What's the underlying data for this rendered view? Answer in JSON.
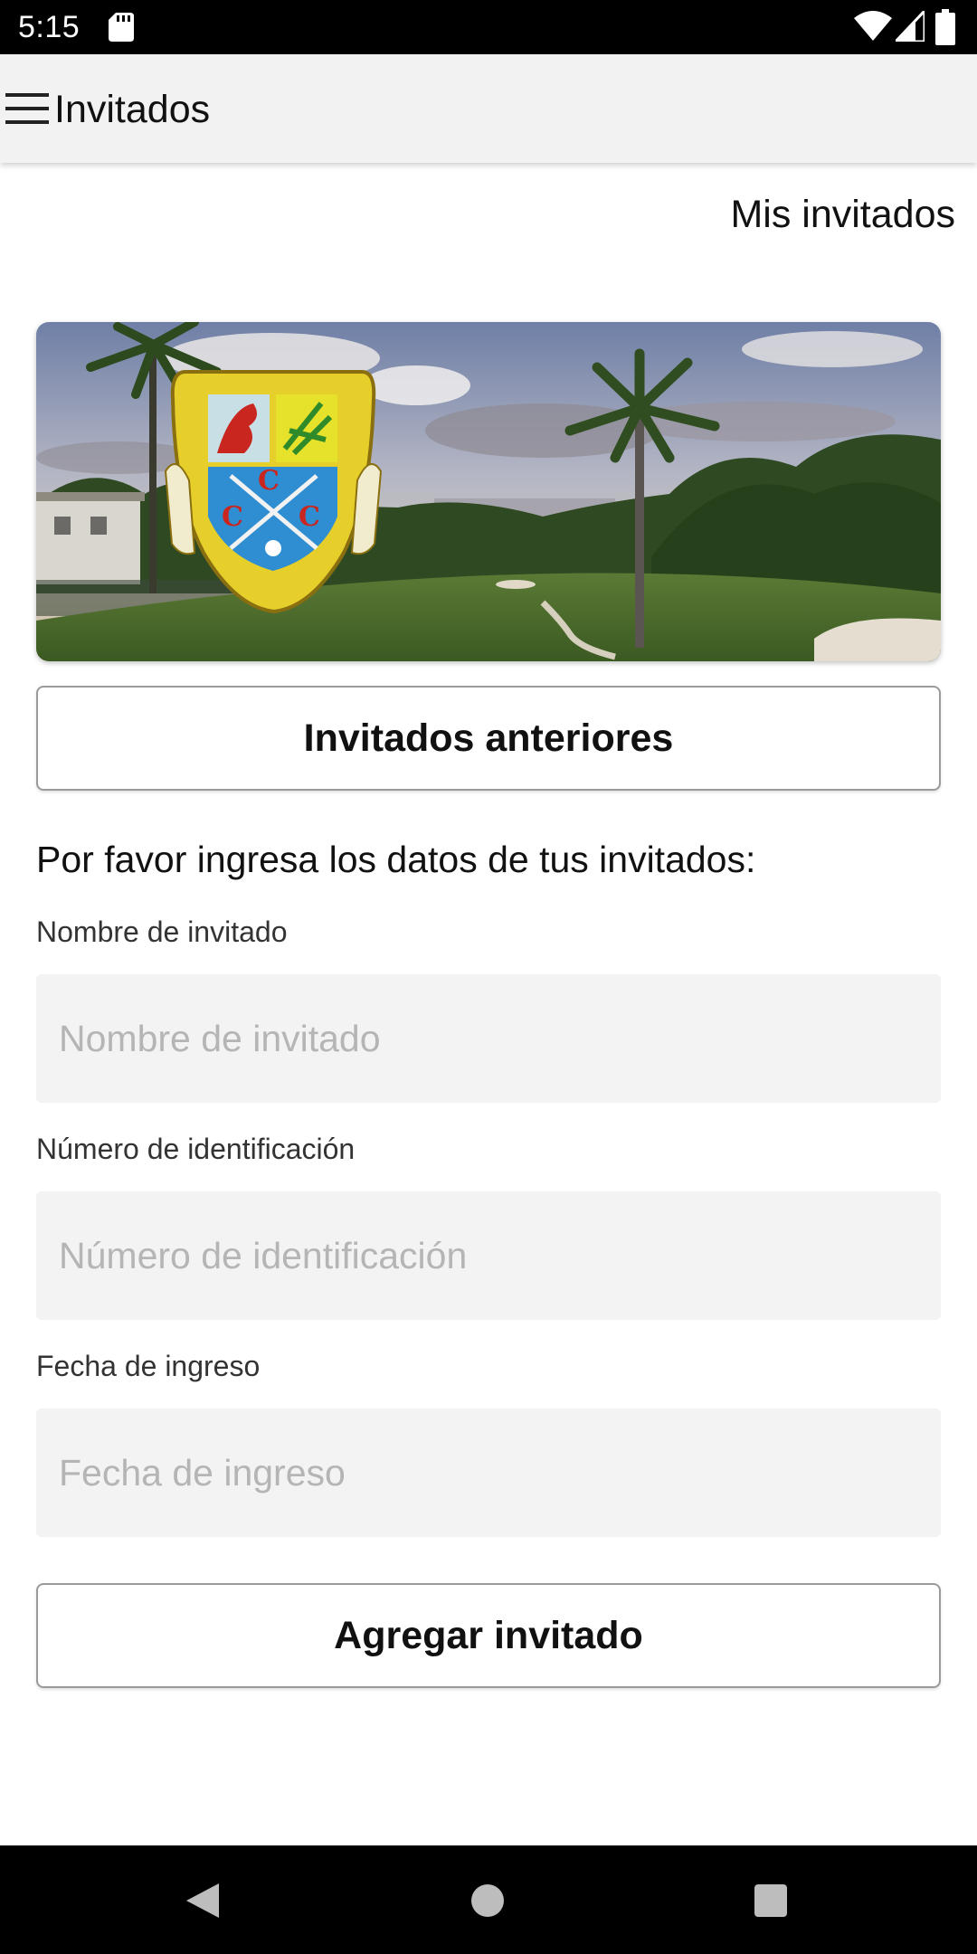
{
  "status_bar": {
    "time": "5:15",
    "icons": [
      "sd-card-icon",
      "wifi-icon",
      "signal-icon",
      "battery-icon"
    ]
  },
  "app_bar": {
    "menu_icon": "hamburger-menu-icon",
    "title": "Invitados"
  },
  "header_link": "Mis invitados",
  "hero_image": "golf-course-club-crest-banner",
  "previous_guests_button": "Invitados anteriores",
  "instructions": "Por favor ingresa los datos de tus invitados:",
  "form": {
    "fields": [
      {
        "label": "Nombre de invitado",
        "placeholder": "Nombre de invitado",
        "value": ""
      },
      {
        "label": "Número de identificación",
        "placeholder": "Número de identificación",
        "value": ""
      },
      {
        "label": "Fecha de ingreso",
        "placeholder": "Fecha de ingreso",
        "value": ""
      }
    ],
    "submit_label": "Agregar invitado"
  },
  "nav_bar": {
    "icons": [
      "back-icon",
      "home-icon",
      "recents-icon"
    ]
  },
  "colors": {
    "status_bar": "#000000",
    "app_bar": "#f2f2f2",
    "input_background": "#f3f3f3",
    "placeholder": "#b5b5b5",
    "button_border": "#9a9a9a"
  }
}
